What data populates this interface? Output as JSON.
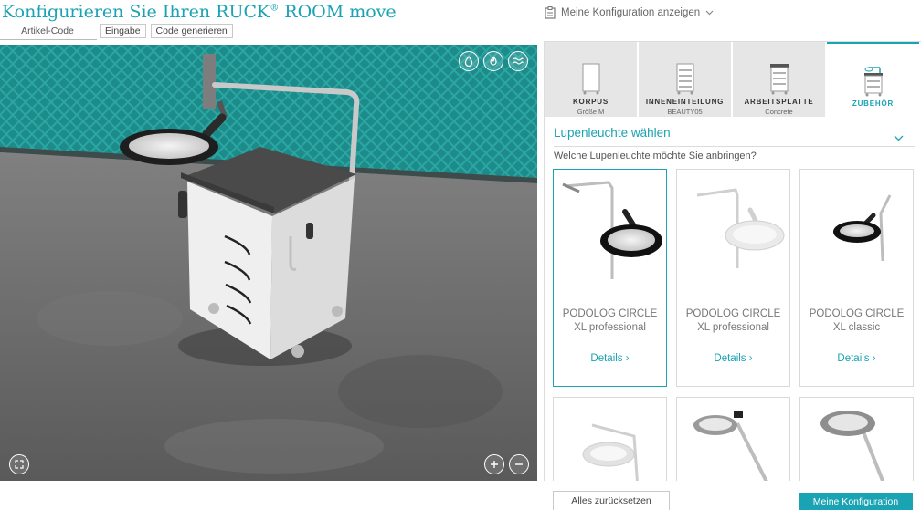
{
  "header": {
    "title_main": "Konfigurieren Sie Ihren RUCK",
    "title_reg": "®",
    "title_tail": " ROOM move",
    "code_label": "Artikel-Code",
    "input_button": "Eingabe",
    "generate_button": "Code generieren",
    "show_config": "Meine Konfiguration anzeigen"
  },
  "viewer": {
    "top_icons": [
      "water-drop-icon",
      "flame-icon",
      "wave-icon"
    ],
    "fullscreen_icon": "fullscreen-icon",
    "zoom_in_icon": "plus-icon",
    "zoom_out_icon": "minus-icon"
  },
  "tabs": [
    {
      "label": "KORPUS",
      "sub": "Größe M"
    },
    {
      "label": "INNENEINTEILUNG",
      "sub": "BEAUTY05"
    },
    {
      "label": "ARBEITSPLATTE",
      "sub": "Concrete"
    },
    {
      "label": "ZUBEHÖR",
      "sub": ""
    }
  ],
  "section": {
    "title": "Lupenleuchte wählen",
    "question": "Welche Lupenleuchte möchte Sie anbringen?"
  },
  "cards": [
    {
      "name": "PODOLOG CIRCLE XL professional",
      "details": "Details"
    },
    {
      "name": "PODOLOG CIRCLE XL professional",
      "details": "Details"
    },
    {
      "name": "PODOLOG CIRCLE XL classic",
      "details": "Details"
    }
  ],
  "footer": {
    "reset": "Alles zurücksetzen",
    "my_config": "Meine Konfiguration"
  },
  "colors": {
    "accent": "#1aa3b3",
    "wall": "#1f8f8e",
    "floor": "#6b6b6b",
    "tab_bg": "#e6e6e6"
  }
}
